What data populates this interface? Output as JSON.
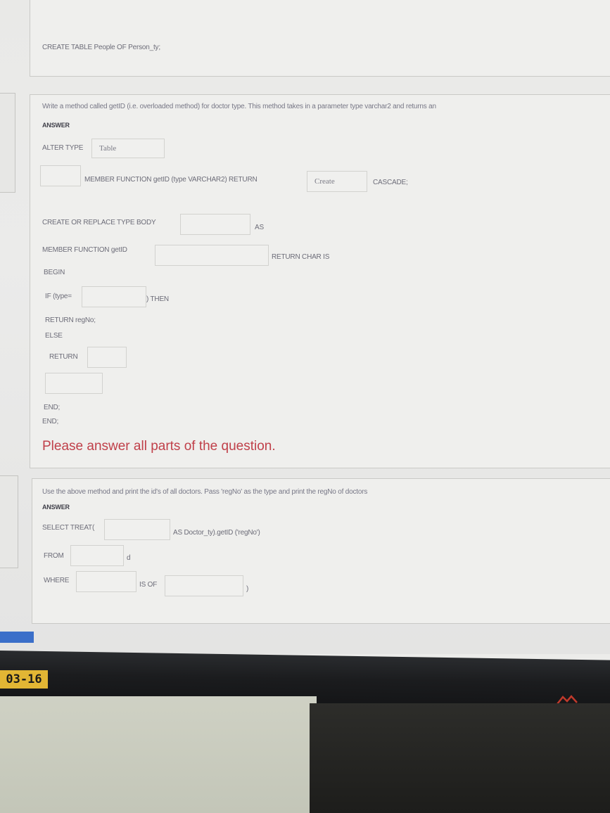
{
  "q1": {
    "code_line": "CREATE TABLE People OF Person_ty;"
  },
  "q2": {
    "question": "Write a method called getID (i.e. overloaded method) for doctor type. This method takes in a parameter type varchar2 and returns an",
    "answer_label": "ANSWER",
    "alter_type": "ALTER TYPE",
    "alter_value": "Table",
    "member_function_line": "MEMBER FUNCTION getID (type VARCHAR2) RETURN",
    "return_value": "Create",
    "cascade": "CASCADE;",
    "create_replace": "CREATE OR REPLACE TYPE BODY",
    "as": "AS",
    "member_function": "MEMBER FUNCTION getID",
    "return_char": "RETURN CHAR IS",
    "begin": "BEGIN",
    "if_type": "IF (type=",
    "then": ") THEN",
    "return_regno": "RETURN regNo;",
    "else": "ELSE",
    "return": "RETURN",
    "end1": "END;",
    "end2": "END;",
    "warning": "Please answer all parts of the question."
  },
  "q3": {
    "question": "Use the above method and print the id's of all doctors. Pass 'regNo' as the type and print the regNo of doctors",
    "answer_label": "ANSWER",
    "select_treat": "SELECT TREAT(",
    "as_doctor": "AS Doctor_ty).getID ('regNo')",
    "from": "FROM",
    "d": "d",
    "where": "WHERE",
    "is_of": "IS OF",
    "close": ")"
  },
  "taskbar": {
    "date": "03-16"
  },
  "colors": {
    "warning": "#c0404a",
    "badge": "#e2b634",
    "blue_button": "#3b6fc9"
  }
}
